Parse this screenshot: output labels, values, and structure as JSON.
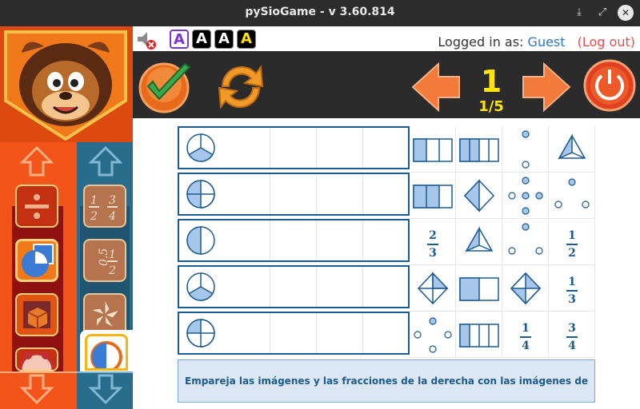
{
  "window": {
    "title": "pySioGame - v 3.60.814",
    "controls": [
      "minimize",
      "maximize",
      "close"
    ]
  },
  "top": {
    "font_sizes": [
      "A",
      "A",
      "A",
      "A"
    ],
    "logged_in_label": "Logged in as:",
    "user": "Guest",
    "logout": "(Log out)"
  },
  "nav": {
    "page": "1",
    "progress": "1/5"
  },
  "sidebar": {
    "categories_left": [
      "division-category",
      "fractions-category",
      "geometry-category",
      "clock-category"
    ],
    "categories_right": [
      "fraction-numbers-category",
      "decimal-fraction-category",
      "shapes-category",
      "fraction-pie-active"
    ]
  },
  "board": {
    "rows": [
      {
        "target": "pie-thirds-1"
      },
      {
        "target": "pie-quarters-2"
      },
      {
        "target": "pie-halves-1"
      },
      {
        "target": "pie-thirds-1b"
      },
      {
        "target": "pie-quarters-1"
      }
    ],
    "options": [
      [
        "rect-3-1",
        "rect-4-2",
        "dots-2-of-3",
        "pyramid-1-3"
      ],
      [
        "rect-3-2",
        "diamond-1-2",
        "dots-4-of-5",
        "dots-1-of-3"
      ],
      [
        {
          "num": "2",
          "den": "3"
        },
        "pyramid-1-3b",
        "dots-1-of-3b",
        {
          "num": "1",
          "den": "2"
        }
      ],
      [
        "diamond-quarters-1",
        "rect-2-1",
        "diamond-quarters-2",
        {
          "num": "1",
          "den": "3"
        }
      ],
      [
        "dots-1-of-4",
        "rect-4-1",
        {
          "num": "1",
          "den": "4"
        },
        {
          "num": "3",
          "den": "4"
        }
      ]
    ],
    "instructions": "Empareja las imágenes y las fracciones de la derecha con las imágenes de la izquierda"
  },
  "colors": {
    "accent_blue": "#1d5a90",
    "shape_fill": "#a7c6ec",
    "orange": "#f2541a",
    "teal": "#2a6c8c",
    "yellow": "#ffe400"
  }
}
